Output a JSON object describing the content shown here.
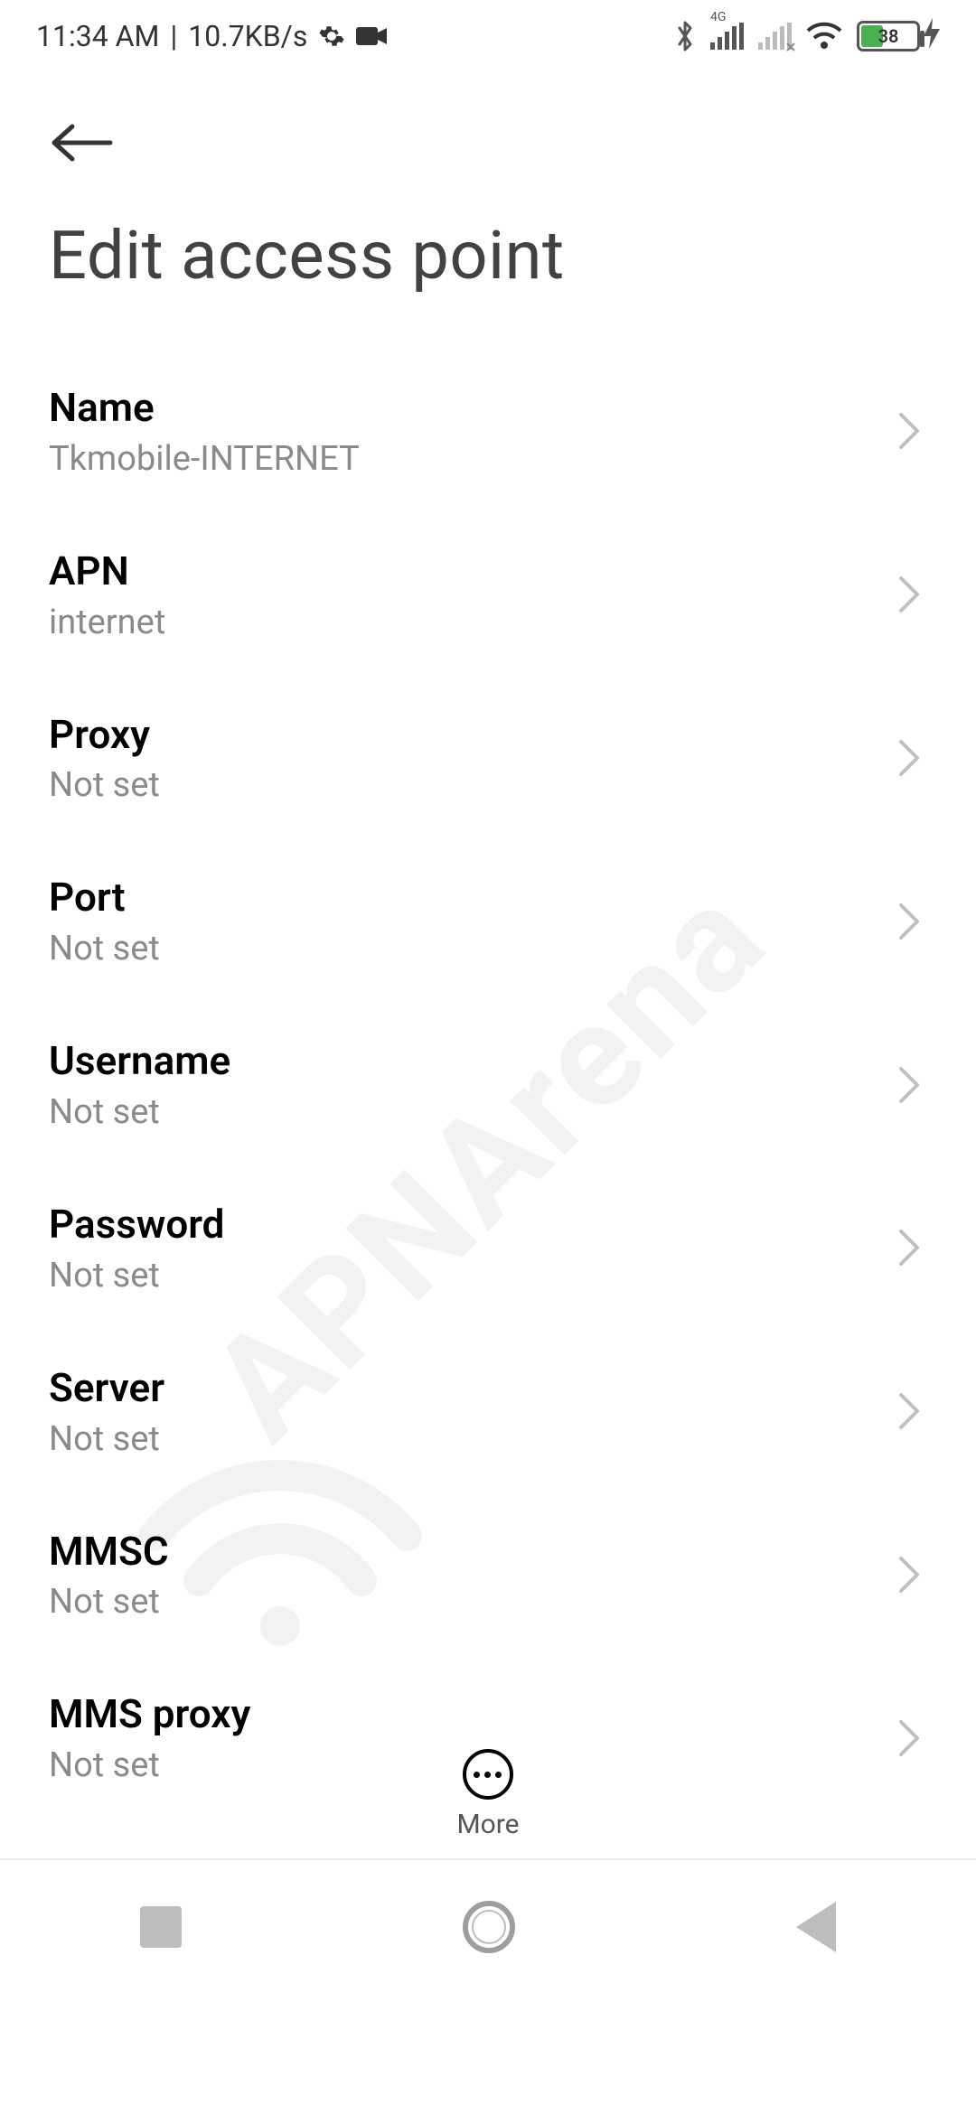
{
  "status": {
    "time": "11:34 AM",
    "separator": "|",
    "net_speed": "10.7KB/s",
    "battery_pct": "38",
    "cell_label": "4G"
  },
  "page": {
    "title": "Edit access point"
  },
  "fields": [
    {
      "label": "Name",
      "value": "Tkmobile-INTERNET"
    },
    {
      "label": "APN",
      "value": "internet"
    },
    {
      "label": "Proxy",
      "value": "Not set"
    },
    {
      "label": "Port",
      "value": "Not set"
    },
    {
      "label": "Username",
      "value": "Not set"
    },
    {
      "label": "Password",
      "value": "Not set"
    },
    {
      "label": "Server",
      "value": "Not set"
    },
    {
      "label": "MMSC",
      "value": "Not set"
    },
    {
      "label": "MMS proxy",
      "value": "Not set"
    }
  ],
  "bottom": {
    "more_label": "More"
  },
  "watermark": "APNArena"
}
